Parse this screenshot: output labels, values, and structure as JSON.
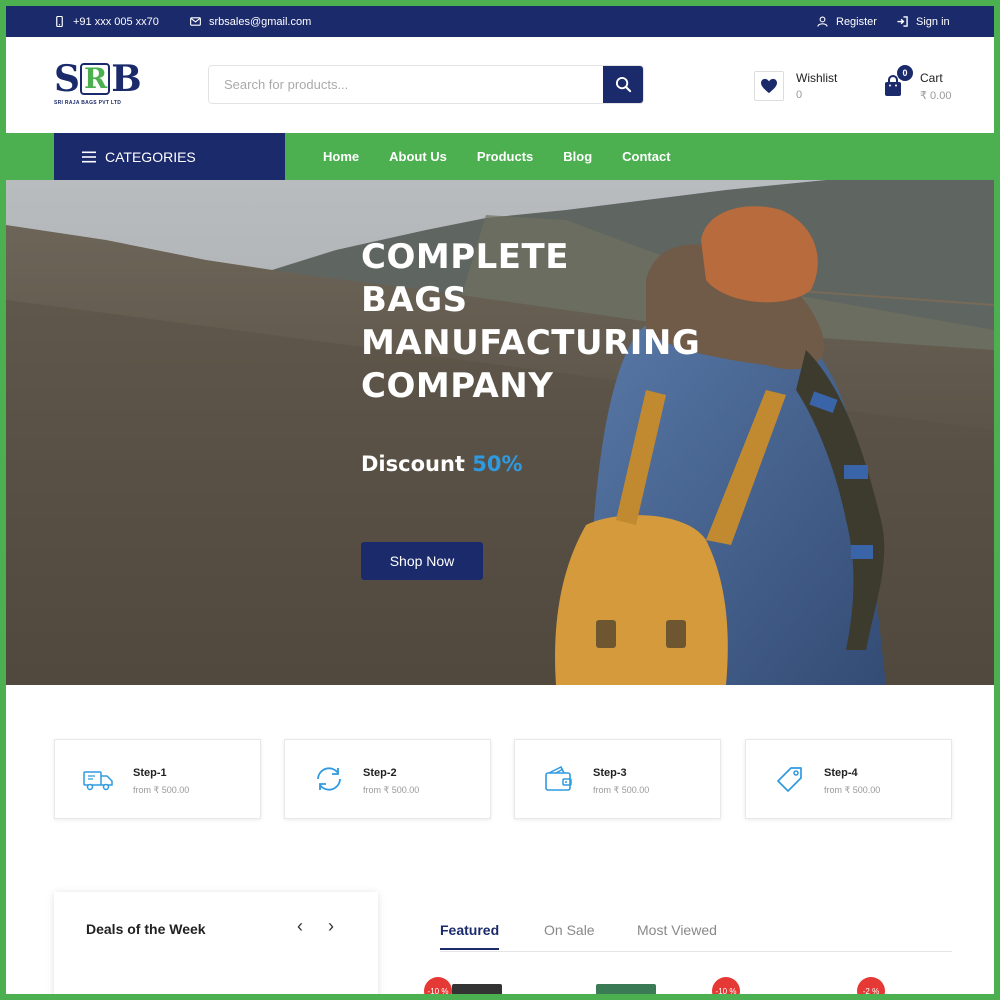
{
  "topbar": {
    "phone": "+91 xxx 005 xx70",
    "email": "srbsales@gmail.com",
    "register": "Register",
    "signin": "Sign in"
  },
  "logo": {
    "letters": [
      "S",
      "R",
      "B"
    ],
    "subtitle": "SRI RAJA BAGS PVT LTD"
  },
  "search": {
    "placeholder": "Search for products..."
  },
  "wishlist": {
    "label": "Wishlist",
    "count": "0"
  },
  "cart": {
    "label": "Cart",
    "amount": "₹ 0.00",
    "badge": "0"
  },
  "nav": {
    "categories_label": "CATEGORIES",
    "links": [
      "Home",
      "About Us",
      "Products",
      "Blog",
      "Contact"
    ]
  },
  "hero": {
    "title_lines": [
      "COMPLETE",
      "BAGS",
      "MANUFACTURING",
      "COMPANY"
    ],
    "discount_label": "Discount",
    "discount_value": "50%",
    "button": "Shop Now"
  },
  "steps": [
    {
      "title": "Step-1",
      "subtitle": "from ₹ 500.00",
      "icon": "truck-icon"
    },
    {
      "title": "Step-2",
      "subtitle": "from ₹ 500.00",
      "icon": "refresh-icon"
    },
    {
      "title": "Step-3",
      "subtitle": "from ₹ 500.00",
      "icon": "wallet-icon"
    },
    {
      "title": "Step-4",
      "subtitle": "from ₹ 500.00",
      "icon": "tag-icon"
    }
  ],
  "deals": {
    "title": "Deals of the Week",
    "prev": "‹",
    "next": "›"
  },
  "product_tabs": [
    "Featured",
    "On Sale",
    "Most Viewed"
  ],
  "sale_badges": [
    "-10 %",
    "-10 %",
    "-2 %"
  ],
  "colors": {
    "navy": "#1b2a6b",
    "green": "#4caf50",
    "accent_blue": "#2f9ae0",
    "sale_red": "#e53935"
  }
}
